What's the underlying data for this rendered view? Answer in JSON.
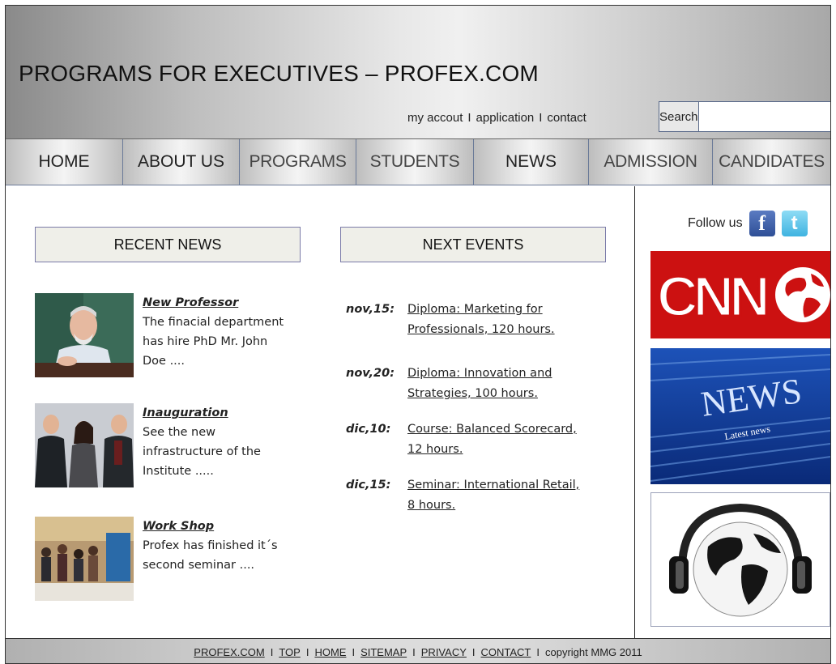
{
  "header": {
    "title": "PROGRAMS FOR EXECUTIVES – PROFEX.COM",
    "util_links": [
      "my accout",
      "application",
      "contact"
    ],
    "search_label": "Search",
    "search_value": ""
  },
  "nav": {
    "items": [
      "HOME",
      "ABOUT US",
      "PROGRAMS",
      "STUDENTS",
      "NEWS",
      "ADMISSION",
      "CANDIDATES"
    ]
  },
  "recent_news": {
    "heading": "RECENT NEWS",
    "items": [
      {
        "title": "New Professor",
        "body": "The finacial department  has hire PhD Mr. John Doe ...."
      },
      {
        "title": "Inauguration",
        "body": "See the new infrastructure of the Institute ....."
      },
      {
        "title": "Work Shop",
        "body": "Profex has finished it´s second seminar ...."
      }
    ]
  },
  "next_events": {
    "heading": "NEXT EVENTS",
    "items": [
      {
        "date": "nov,15:",
        "text": "Diploma: Marketing for Professionals, 120 hours."
      },
      {
        "date": "nov,20:",
        "text": "Diploma: Innovation  and Strategies, 100 hours."
      },
      {
        "date": "dic,10:",
        "text": "Course: Balanced Scorecard, 12 hours."
      },
      {
        "date": "dic,15:",
        "text": "Seminar: International Retail, 8 hours."
      }
    ]
  },
  "sidebar": {
    "follow_label": "Follow us",
    "facebook_glyph": "f",
    "twitter_glyph": "t",
    "cnn_logo_text": "CNN",
    "news_image_text": "NEWS",
    "news_image_sub": "Latest news"
  },
  "footer": {
    "links": [
      "PROFEX.COM",
      "TOP",
      "HOME",
      "SITEMAP",
      "PRIVACY",
      "CONTACT"
    ],
    "copyright": "copyright MMG 2011"
  },
  "colors": {
    "nav_border": "#6a7a98",
    "section_border": "#7a7aa8",
    "cnn_red": "#cc1111",
    "news_blue": "#1a4fa8"
  }
}
